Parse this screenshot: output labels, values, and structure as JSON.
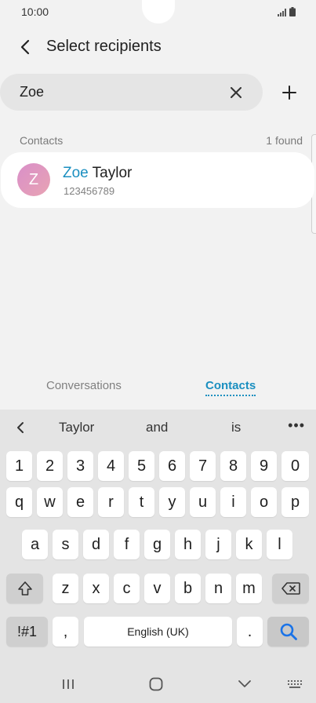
{
  "status": {
    "time": "10:00"
  },
  "header": {
    "title": "Select recipients"
  },
  "search": {
    "value": "Zoe"
  },
  "results": {
    "section_label": "Contacts",
    "found": "1 found"
  },
  "contact": {
    "initial": "Z",
    "name_match": "Zoe",
    "name_rest": " Taylor",
    "phone": "123456789"
  },
  "tabs": {
    "conversations": "Conversations",
    "contacts": "Contacts"
  },
  "keyboard": {
    "suggestions": [
      "Taylor",
      "and",
      "is"
    ],
    "more": "•••",
    "row_numbers": [
      "1",
      "2",
      "3",
      "4",
      "5",
      "6",
      "7",
      "8",
      "9",
      "0"
    ],
    "row1": [
      "q",
      "w",
      "e",
      "r",
      "t",
      "y",
      "u",
      "i",
      "o",
      "p"
    ],
    "row2": [
      "a",
      "s",
      "d",
      "f",
      "g",
      "h",
      "j",
      "k",
      "l"
    ],
    "row3": [
      "z",
      "x",
      "c",
      "v",
      "b",
      "n",
      "m"
    ],
    "symbols": "!#1",
    "comma": ",",
    "space": "English (UK)",
    "period": "."
  },
  "colors": {
    "accent": "#1b8fc0",
    "search_key": "#1a73e8"
  }
}
